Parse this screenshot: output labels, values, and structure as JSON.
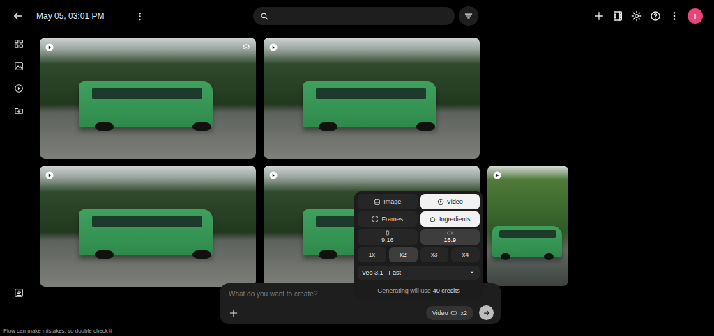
{
  "header": {
    "title": "May 05, 03:01 PM"
  },
  "avatar": {
    "letter": "i"
  },
  "videos": [
    {
      "orientation": "landscape",
      "stacked": true
    },
    {
      "orientation": "landscape",
      "stacked": false
    },
    {
      "orientation": "landscape",
      "stacked": false
    },
    {
      "orientation": "landscape",
      "stacked": false
    },
    {
      "orientation": "portrait",
      "stacked": false
    }
  ],
  "composer": {
    "modes": [
      {
        "label": "Image",
        "selected": false
      },
      {
        "label": "Video",
        "selected": true
      }
    ],
    "inputs": [
      {
        "label": "Frames",
        "selected": false
      },
      {
        "label": "Ingredients",
        "selected": true
      }
    ],
    "ratios": [
      {
        "label": "9:16",
        "selected": false
      },
      {
        "label": "16:9",
        "selected": true
      }
    ],
    "counts": [
      {
        "label": "1x",
        "selected": false
      },
      {
        "label": "x2",
        "selected": true
      },
      {
        "label": "x3",
        "selected": false
      },
      {
        "label": "x4",
        "selected": false
      }
    ],
    "model": "Veo 3.1 - Fast",
    "cost": {
      "prefix": "Generating will use",
      "link": "40 credits"
    }
  },
  "prompt": {
    "placeholder": "What do you want to create?",
    "mode": "Video",
    "count": "x2"
  },
  "footer": "Flow can make mistakes, so double check it"
}
